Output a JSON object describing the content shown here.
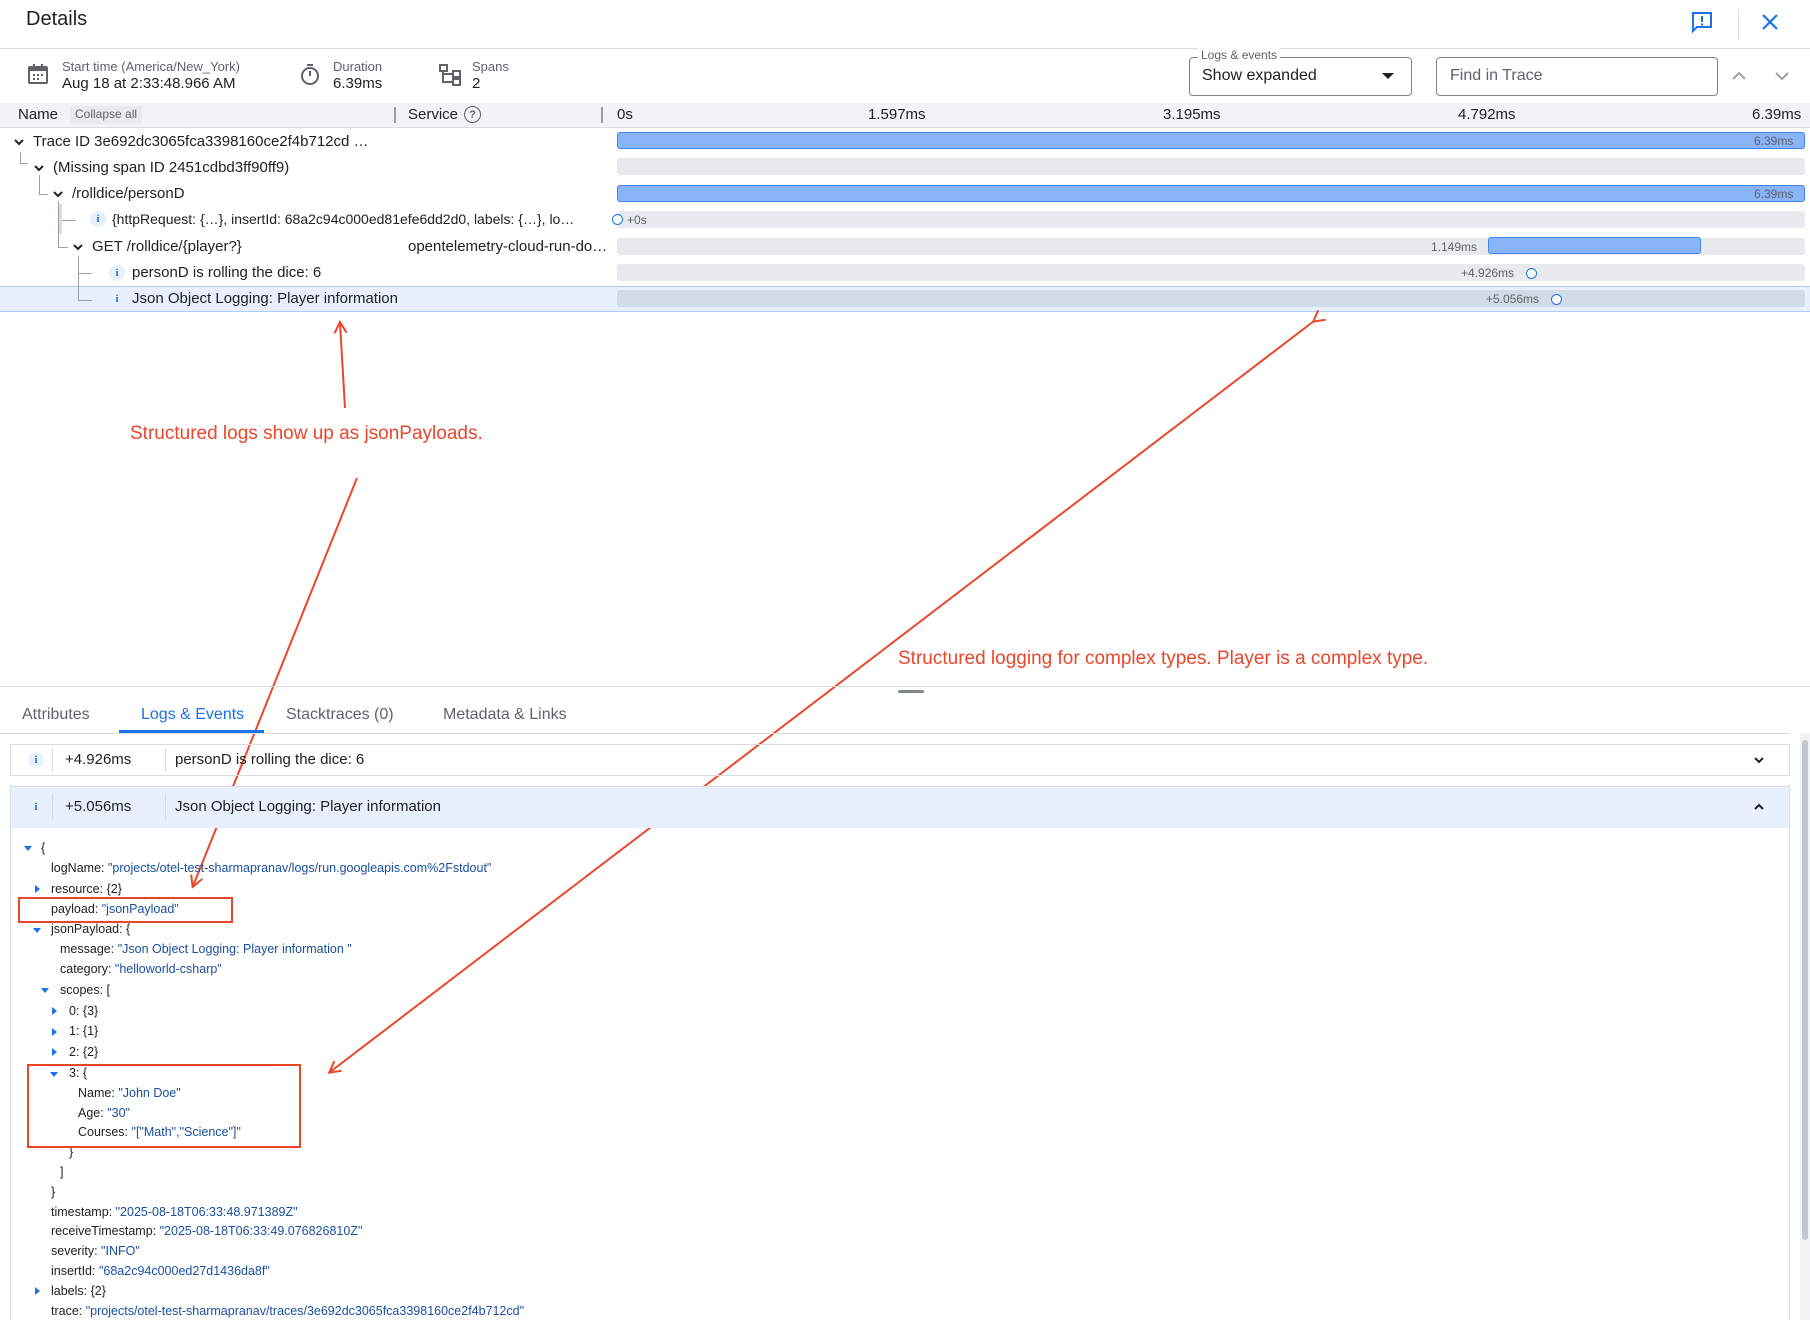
{
  "header": {
    "title": "Details",
    "feedback_icon": "feedback-icon",
    "close_icon": "close-icon"
  },
  "meta": {
    "start_label": "Start time (America/New_York)",
    "start_value": "Aug 18 at 2:33:48.966 AM",
    "duration_label": "Duration",
    "duration_value": "6.39ms",
    "spans_label": "Spans",
    "spans_value": "2"
  },
  "logs_events": {
    "label": "Logs & events",
    "value": "Show expanded"
  },
  "find": {
    "placeholder": "Find in Trace"
  },
  "columns": {
    "name": "Name",
    "collapse_all": "Collapse all",
    "service": "Service",
    "ticks": [
      "0s",
      "1.597ms",
      "3.195ms",
      "4.792ms",
      "6.39ms"
    ]
  },
  "rows": [
    {
      "label": "Trace ID 3e692dc3065fca3398160ce2f4b712cd …",
      "service": "",
      "bar_label": "6.39ms"
    },
    {
      "label": "(Missing span ID 2451cdbd3ff90ff9)",
      "service": ""
    },
    {
      "label": "/rolldice/personD",
      "service": "",
      "bar_label": "6.39ms"
    },
    {
      "label": "{httpRequest: {…}, insertId: 68a2c94c000ed81efe6dd2d0, labels: {…}, lo…",
      "service": "",
      "event_label": "+0s"
    },
    {
      "label": "GET /rolldice/{player?}",
      "service": "opentelemetry-cloud-run-do…",
      "bar_label": "1.149ms"
    },
    {
      "label": "personD is rolling the dice: 6",
      "service": "",
      "event_label": "+4.926ms"
    },
    {
      "label": "Json Object Logging: Player information",
      "service": "",
      "event_label": "+5.056ms"
    }
  ],
  "annotations": {
    "a1": "Structured logs show up as jsonPayloads.",
    "a2": "Structured logging for complex types. Player is a complex type."
  },
  "tabs": [
    "Attributes",
    "Logs & Events",
    "Stacktraces (0)",
    "Metadata & Links"
  ],
  "logs": [
    {
      "time": "+4.926ms",
      "message": "personD is rolling the dice: 6"
    },
    {
      "time": "+5.056ms",
      "message": "Json Object Logging: Player information"
    }
  ],
  "json": {
    "open_brace": "{",
    "close_brace": "}",
    "open_bracket": "[",
    "close_bracket": "]",
    "logName_k": "logName:",
    "logName_v": "\"projects/otel-test-sharmapranav/logs/run.googleapis.com%2Fstdout\"",
    "resource": "resource: {2}",
    "payload_k": "payload:",
    "payload_v": "\"jsonPayload\"",
    "jsonPayload": "jsonPayload: {",
    "message_k": "message:",
    "message_v": "\"Json Object Logging: Player information \"",
    "category_k": "category:",
    "category_v": "\"helloworld-csharp\"",
    "scopes": "scopes: [",
    "s0": "0: {3}",
    "s1": "1: {1}",
    "s2": "2: {2}",
    "s3": "3: {",
    "name_k": "Name:",
    "name_v": "\"John Doe\"",
    "age_k": "Age:",
    "age_v": "\"30\"",
    "courses_k": "Courses:",
    "courses_v": "\"[\"Math\",\"Science\"]\"",
    "timestamp_k": "timestamp:",
    "timestamp_v": "\"2025-08-18T06:33:48.971389Z\"",
    "receive_k": "receiveTimestamp:",
    "receive_v": "\"2025-08-18T06:33:49.076826810Z\"",
    "severity_k": "severity:",
    "severity_v": "\"INFO\"",
    "insert_k": "insertId:",
    "insert_v": "\"68a2c94c000ed27d1436da8f\"",
    "labels": "labels: {2}",
    "trace_k": "trace:",
    "trace_v": "\"projects/otel-test-sharmapranav/traces/3e692dc3065fca3398160ce2f4b712cd\""
  },
  "colors": {
    "accent": "#1a73e8",
    "bar": "#8ab4f8",
    "annotation": "#e8472b"
  }
}
